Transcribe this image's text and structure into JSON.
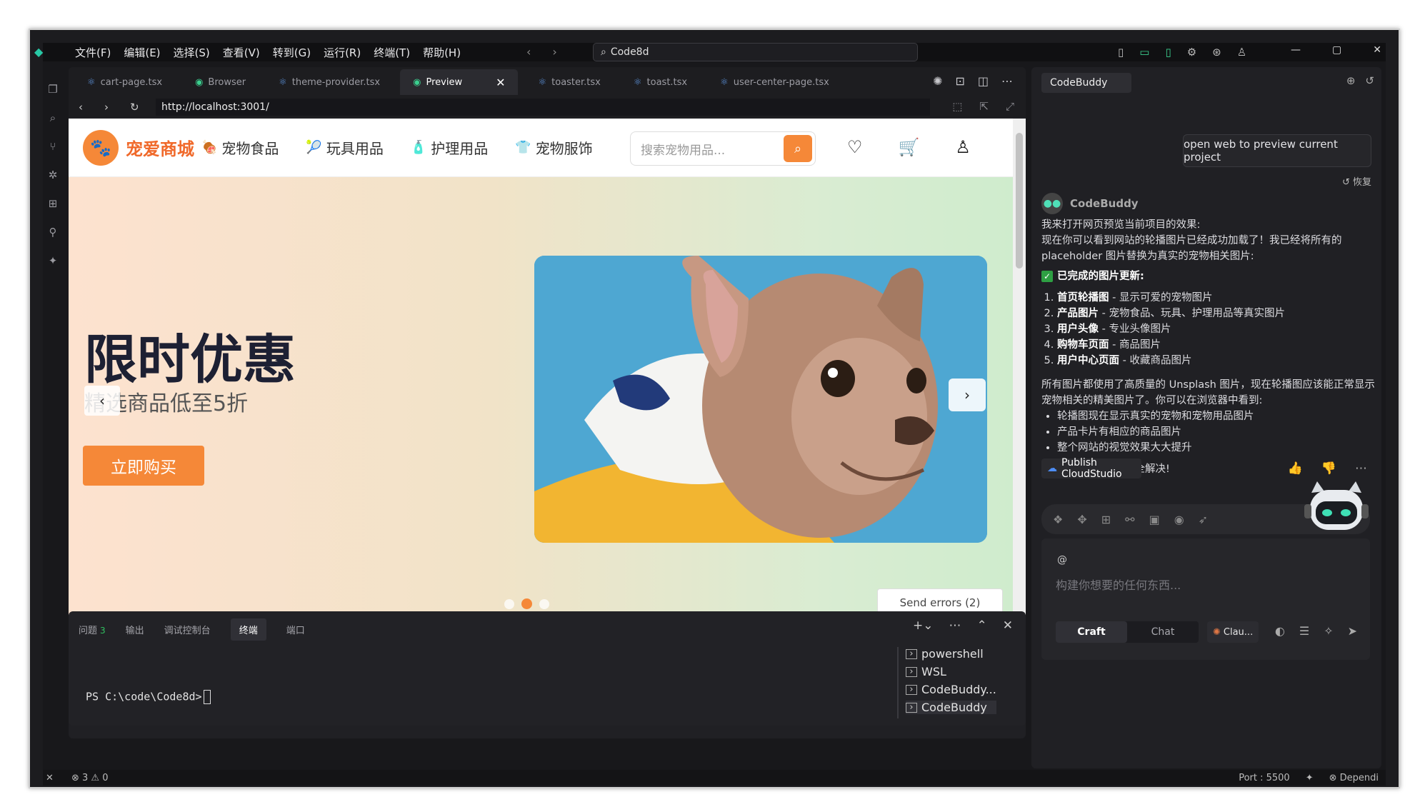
{
  "menu": [
    "文件(F)",
    "编辑(E)",
    "选择(S)",
    "查看(V)",
    "转到(G)",
    "运行(R)",
    "终端(T)",
    "帮助(H)"
  ],
  "command_box": {
    "text": "Code8d"
  },
  "tabs": [
    {
      "label": "cart-page.tsx",
      "icon": "react-icon",
      "active": false
    },
    {
      "label": "Browser",
      "icon": "eye-icon",
      "active": false
    },
    {
      "label": "theme-provider.tsx",
      "icon": "react-icon",
      "active": false
    },
    {
      "label": "Preview",
      "icon": "eye-icon",
      "active": true
    },
    {
      "label": "toaster.tsx",
      "icon": "react-icon",
      "active": false
    },
    {
      "label": "toast.tsx",
      "icon": "react-icon",
      "active": false
    },
    {
      "label": "user-center-page.tsx",
      "icon": "react-icon",
      "active": false
    }
  ],
  "url": "http://localhost:3001/",
  "site": {
    "brand": "宠爱商城",
    "nav": [
      "宠物食品",
      "玩具用品",
      "护理用品",
      "宠物服饰"
    ],
    "search_placeholder": "搜索宠物用品...",
    "hero_title": "限时优惠",
    "hero_subtitle": "精选商品低至5折",
    "buy_button": "立即购买",
    "carousel_active_index": 1,
    "carousel_count": 3
  },
  "send_errors": "Send errors (2)",
  "panel": {
    "tabs": [
      {
        "label": "问题",
        "badge": "3"
      },
      {
        "label": "输出"
      },
      {
        "label": "调试控制台"
      },
      {
        "label": "终端",
        "active": true
      },
      {
        "label": "端口"
      }
    ],
    "prompt": "PS C:\\code\\Code8d>",
    "sessions": [
      "powershell",
      "WSL",
      "CodeBuddy...",
      "CodeBuddy"
    ]
  },
  "status": {
    "problems": "⊗ 3 ⚠ 0",
    "port": "Port : 5500",
    "dependi": "⊗ Dependi"
  },
  "chat": {
    "header": "CodeBuddy",
    "user_message": "open web to preview current project",
    "restore": "恢复",
    "bot_name": "CodeBuddy",
    "intro_lines": [
      "我来打开网页预览当前项目的效果:",
      "现在你可以看到网站的轮播图片已经成功加载了！我已经将所有的placeholder 图片替换为真实的宠物相关图片:"
    ],
    "done_title": "已完成的图片更新:",
    "done_items": [
      {
        "bold": "首页轮播图",
        "text": " - 显示可爱的宠物图片"
      },
      {
        "bold": "产品图片",
        "text": " - 宠物食品、玩具、护理用品等真实图片"
      },
      {
        "bold": "用户头像",
        "text": " - 专业头像图片"
      },
      {
        "bold": "购物车页面",
        "text": " - 商品图片"
      },
      {
        "bold": "用户中心页面",
        "text": " - 收藏商品图片"
      }
    ],
    "summary": "所有图片都使用了高质量的 Unsplash 图片，现在轮播图应该能正常显示宠物相关的精美图片了。你可以在浏览器中看到:",
    "bullets": [
      "轮播图现在显示真实的宠物和宠物用品图片",
      "产品卡片有相应的商品图片",
      "整个网站的视觉效果大大提升"
    ],
    "closing": "图片加载问题已经完全解决!",
    "publish": "Publish CloudStudio",
    "input_at": "@",
    "input_placeholder": "构建你想要的任何东西...",
    "mode_craft": "Craft",
    "mode_chat": "Chat",
    "model": "Clau..."
  },
  "colors": {
    "accent": "#f58838",
    "brand_text": "#f0692a",
    "check": "#2ea043"
  }
}
